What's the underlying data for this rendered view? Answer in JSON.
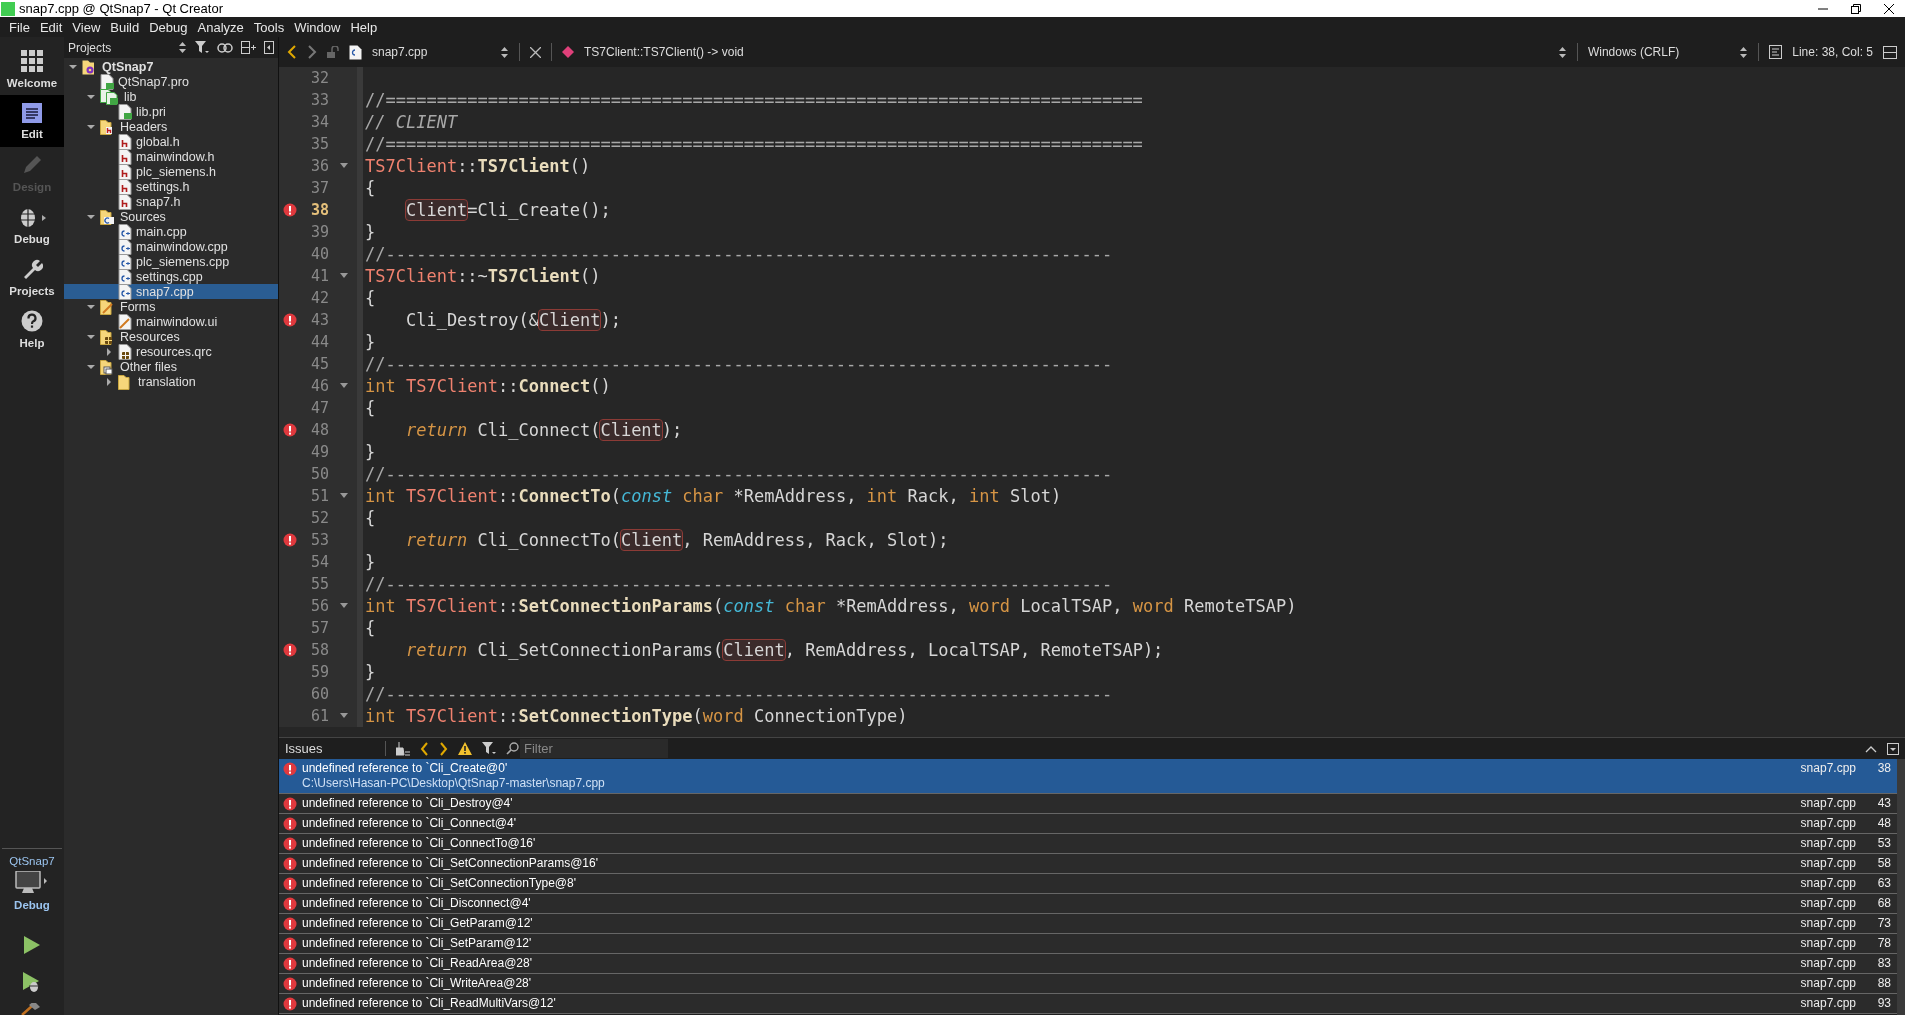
{
  "window": {
    "title": "snap7.cpp @ QtSnap7 - Qt Creator"
  },
  "menu": [
    "File",
    "Edit",
    "View",
    "Build",
    "Debug",
    "Analyze",
    "Tools",
    "Window",
    "Help"
  ],
  "modes": [
    {
      "kind": "welcome",
      "label": "Welcome",
      "selected": false,
      "disabled": false
    },
    {
      "kind": "edit",
      "label": "Edit",
      "selected": true,
      "disabled": false
    },
    {
      "kind": "design",
      "label": "Design",
      "selected": false,
      "disabled": true
    },
    {
      "kind": "debug",
      "label": "Debug",
      "selected": false,
      "disabled": false
    },
    {
      "kind": "projects",
      "label": "Projects",
      "selected": false,
      "disabled": false
    },
    {
      "kind": "help",
      "label": "Help",
      "selected": false,
      "disabled": false
    }
  ],
  "kit": {
    "project": "QtSnap7",
    "config": "Debug"
  },
  "projects": {
    "title": "Projects",
    "tree": [
      {
        "label": "QtSnap7",
        "kind": "project",
        "expanded": true,
        "selected": false,
        "children": [
          {
            "label": "QtSnap7.pro",
            "kind": "qtfile",
            "selected": false
          },
          {
            "label": "lib",
            "kind": "qtfolder",
            "expanded": true,
            "selected": false,
            "children": [
              {
                "label": "lib.pri",
                "kind": "qtfile",
                "selected": false
              }
            ]
          },
          {
            "label": "Headers",
            "kind": "hfolder",
            "expanded": true,
            "selected": false,
            "children": [
              {
                "label": "global.h",
                "kind": "h",
                "selected": false
              },
              {
                "label": "mainwindow.h",
                "kind": "h",
                "selected": false
              },
              {
                "label": "plc_siemens.h",
                "kind": "h",
                "selected": false
              },
              {
                "label": "settings.h",
                "kind": "h",
                "selected": false
              },
              {
                "label": "snap7.h",
                "kind": "h",
                "selected": false
              }
            ]
          },
          {
            "label": "Sources",
            "kind": "cppfolder",
            "expanded": true,
            "selected": false,
            "children": [
              {
                "label": "main.cpp",
                "kind": "cpp",
                "selected": false
              },
              {
                "label": "mainwindow.cpp",
                "kind": "cpp",
                "selected": false
              },
              {
                "label": "plc_siemens.cpp",
                "kind": "cpp",
                "selected": false
              },
              {
                "label": "settings.cpp",
                "kind": "cpp",
                "selected": false
              },
              {
                "label": "snap7.cpp",
                "kind": "cpp",
                "selected": true
              }
            ]
          },
          {
            "label": "Forms",
            "kind": "formfolder",
            "expanded": true,
            "selected": false,
            "children": [
              {
                "label": "mainwindow.ui",
                "kind": "ui",
                "selected": false
              }
            ]
          },
          {
            "label": "Resources",
            "kind": "resfolder",
            "expanded": true,
            "selected": false,
            "children": [
              {
                "label": "resources.qrc",
                "kind": "qrc",
                "expanded": false,
                "selected": false
              }
            ]
          },
          {
            "label": "Other files",
            "kind": "otherfolder",
            "expanded": true,
            "selected": false,
            "children": [
              {
                "label": "translation",
                "kind": "folder",
                "expanded": false,
                "selected": false
              }
            ]
          }
        ]
      }
    ]
  },
  "editor": {
    "file": "snap7.cpp",
    "symbol": "TS7Client::TS7Client() -> void",
    "line_ending": "Windows (CRLF)",
    "position": "Line: 38, Col: 5",
    "lines": [
      {
        "number": "32",
        "error": false,
        "fold": false,
        "current": false,
        "indent": false
      },
      {
        "number": "33",
        "error": false,
        "fold": false,
        "current": false,
        "indent": false,
        "tokens": [
          {
            "kind": "comment",
            "text": "//=========================================================================="
          }
        ]
      },
      {
        "number": "34",
        "error": false,
        "fold": false,
        "current": false,
        "indent": false,
        "tokens": [
          {
            "kind": "comment-italic",
            "text": "// CLIENT"
          }
        ]
      },
      {
        "number": "35",
        "error": false,
        "fold": false,
        "current": false,
        "indent": false,
        "tokens": [
          {
            "kind": "comment",
            "text": "//=========================================================================="
          }
        ]
      },
      {
        "number": "36",
        "error": false,
        "fold": true,
        "current": false,
        "indent": false,
        "tokens": [
          {
            "kind": "class",
            "text": "TS7Client"
          },
          {
            "kind": "plain",
            "text": "::"
          },
          {
            "kind": "func",
            "text": "TS7Client"
          },
          {
            "kind": "plain",
            "text": "()"
          }
        ]
      },
      {
        "number": "37",
        "error": false,
        "fold": false,
        "current": false,
        "indent": false,
        "tokens": [
          {
            "kind": "plain",
            "text": "{"
          }
        ]
      },
      {
        "number": "38",
        "error": true,
        "fold": false,
        "current": true,
        "indent": true,
        "tokens": [
          {
            "kind": "ref",
            "text": "Client"
          },
          {
            "kind": "plain",
            "text": "=Cli_Create();"
          }
        ]
      },
      {
        "number": "39",
        "error": false,
        "fold": false,
        "current": false,
        "indent": false,
        "tokens": [
          {
            "kind": "plain",
            "text": "}"
          }
        ]
      },
      {
        "number": "40",
        "error": false,
        "fold": false,
        "current": false,
        "indent": false,
        "tokens": [
          {
            "kind": "comment",
            "text": "//-----------------------------------------------------------------------"
          }
        ]
      },
      {
        "number": "41",
        "error": false,
        "fold": true,
        "current": false,
        "indent": false,
        "tokens": [
          {
            "kind": "class",
            "text": "TS7Client"
          },
          {
            "kind": "plain",
            "text": "::~"
          },
          {
            "kind": "func",
            "text": "TS7Client"
          },
          {
            "kind": "plain",
            "text": "()"
          }
        ]
      },
      {
        "number": "42",
        "error": false,
        "fold": false,
        "current": false,
        "indent": false,
        "tokens": [
          {
            "kind": "plain",
            "text": "{"
          }
        ]
      },
      {
        "number": "43",
        "error": true,
        "fold": false,
        "current": false,
        "indent": true,
        "tokens": [
          {
            "kind": "plain",
            "text": "Cli_Destroy(&"
          },
          {
            "kind": "ref",
            "text": "Client"
          },
          {
            "kind": "plain",
            "text": ");"
          }
        ]
      },
      {
        "number": "44",
        "error": false,
        "fold": false,
        "current": false,
        "indent": false,
        "tokens": [
          {
            "kind": "plain",
            "text": "}"
          }
        ]
      },
      {
        "number": "45",
        "error": false,
        "fold": false,
        "current": false,
        "indent": false,
        "tokens": [
          {
            "kind": "comment",
            "text": "//-----------------------------------------------------------------------"
          }
        ]
      },
      {
        "number": "46",
        "error": false,
        "fold": true,
        "current": false,
        "indent": false,
        "tokens": [
          {
            "kind": "keyword",
            "text": "int "
          },
          {
            "kind": "class",
            "text": "TS7Client"
          },
          {
            "kind": "plain",
            "text": "::"
          },
          {
            "kind": "func",
            "text": "Connect"
          },
          {
            "kind": "plain",
            "text": "()"
          }
        ]
      },
      {
        "number": "47",
        "error": false,
        "fold": false,
        "current": false,
        "indent": false,
        "tokens": [
          {
            "kind": "plain",
            "text": "{"
          }
        ]
      },
      {
        "number": "48",
        "error": true,
        "fold": false,
        "current": false,
        "indent": true,
        "tokens": [
          {
            "kind": "keyword-italic",
            "text": "return"
          },
          {
            "kind": "plain",
            "text": " Cli_Connect("
          },
          {
            "kind": "ref",
            "text": "Client"
          },
          {
            "kind": "plain",
            "text": ");"
          }
        ]
      },
      {
        "number": "49",
        "error": false,
        "fold": false,
        "current": false,
        "indent": false,
        "tokens": [
          {
            "kind": "plain",
            "text": "}"
          }
        ]
      },
      {
        "number": "50",
        "error": false,
        "fold": false,
        "current": false,
        "indent": false,
        "tokens": [
          {
            "kind": "comment",
            "text": "//-----------------------------------------------------------------------"
          }
        ]
      },
      {
        "number": "51",
        "error": false,
        "fold": true,
        "current": false,
        "indent": false,
        "tokens": [
          {
            "kind": "keyword",
            "text": "int "
          },
          {
            "kind": "class",
            "text": "TS7Client"
          },
          {
            "kind": "plain",
            "text": "::"
          },
          {
            "kind": "func",
            "text": "ConnectTo"
          },
          {
            "kind": "plain",
            "text": "("
          },
          {
            "kind": "qualifier",
            "text": "const "
          },
          {
            "kind": "keyword",
            "text": "char"
          },
          {
            "kind": "plain",
            "text": " *RemAddress, "
          },
          {
            "kind": "keyword",
            "text": "int"
          },
          {
            "kind": "plain",
            "text": " Rack, "
          },
          {
            "kind": "keyword",
            "text": "int"
          },
          {
            "kind": "plain",
            "text": " Slot)"
          }
        ]
      },
      {
        "number": "52",
        "error": false,
        "fold": false,
        "current": false,
        "indent": false,
        "tokens": [
          {
            "kind": "plain",
            "text": "{"
          }
        ]
      },
      {
        "number": "53",
        "error": true,
        "fold": false,
        "current": false,
        "indent": true,
        "tokens": [
          {
            "kind": "keyword-italic",
            "text": "return"
          },
          {
            "kind": "plain",
            "text": " Cli_ConnectTo("
          },
          {
            "kind": "ref",
            "text": "Client"
          },
          {
            "kind": "plain",
            "text": ", RemAddress, Rack, Slot);"
          }
        ]
      },
      {
        "number": "54",
        "error": false,
        "fold": false,
        "current": false,
        "indent": false,
        "tokens": [
          {
            "kind": "plain",
            "text": "}"
          }
        ]
      },
      {
        "number": "55",
        "error": false,
        "fold": false,
        "current": false,
        "indent": false,
        "tokens": [
          {
            "kind": "comment",
            "text": "//-----------------------------------------------------------------------"
          }
        ]
      },
      {
        "number": "56",
        "error": false,
        "fold": true,
        "current": false,
        "indent": false,
        "tokens": [
          {
            "kind": "keyword",
            "text": "int "
          },
          {
            "kind": "class",
            "text": "TS7Client"
          },
          {
            "kind": "plain",
            "text": "::"
          },
          {
            "kind": "func",
            "text": "SetConnectionParams"
          },
          {
            "kind": "plain",
            "text": "("
          },
          {
            "kind": "qualifier",
            "text": "const "
          },
          {
            "kind": "keyword",
            "text": "char"
          },
          {
            "kind": "plain",
            "text": " *RemAddress, "
          },
          {
            "kind": "keyword",
            "text": "word"
          },
          {
            "kind": "plain",
            "text": " LocalTSAP, "
          },
          {
            "kind": "keyword",
            "text": "word"
          },
          {
            "kind": "plain",
            "text": " RemoteTSAP)"
          }
        ]
      },
      {
        "number": "57",
        "error": false,
        "fold": false,
        "current": false,
        "indent": false,
        "tokens": [
          {
            "kind": "plain",
            "text": "{"
          }
        ]
      },
      {
        "number": "58",
        "error": true,
        "fold": false,
        "current": false,
        "indent": true,
        "tokens": [
          {
            "kind": "keyword-italic",
            "text": "return"
          },
          {
            "kind": "plain",
            "text": " Cli_SetConnectionParams("
          },
          {
            "kind": "ref",
            "text": "Client"
          },
          {
            "kind": "plain",
            "text": ", RemAddress, LocalTSAP, RemoteTSAP);"
          }
        ]
      },
      {
        "number": "59",
        "error": false,
        "fold": false,
        "current": false,
        "indent": false,
        "tokens": [
          {
            "kind": "plain",
            "text": "}"
          }
        ]
      },
      {
        "number": "60",
        "error": false,
        "fold": false,
        "current": false,
        "indent": false,
        "tokens": [
          {
            "kind": "comment",
            "text": "//-----------------------------------------------------------------------"
          }
        ]
      },
      {
        "number": "61",
        "error": false,
        "fold": true,
        "current": false,
        "indent": false,
        "tokens": [
          {
            "kind": "keyword",
            "text": "int "
          },
          {
            "kind": "class",
            "text": "TS7Client"
          },
          {
            "kind": "plain",
            "text": "::"
          },
          {
            "kind": "func",
            "text": "SetConnectionType"
          },
          {
            "kind": "plain",
            "text": "("
          },
          {
            "kind": "keyword",
            "text": "word"
          },
          {
            "kind": "plain",
            "text": " ConnectionType)"
          }
        ]
      }
    ]
  },
  "issues": {
    "title": "Issues",
    "filter_placeholder": "Filter",
    "items": [
      {
        "message": "undefined reference to `Cli_Create@0'",
        "path": "C:\\Users\\Hasan-PC\\Desktop\\QtSnap7-master\\snap7.cpp",
        "file": "snap7.cpp",
        "line": "38",
        "selected": true
      },
      {
        "message": "undefined reference to `Cli_Destroy@4'",
        "file": "snap7.cpp",
        "line": "43",
        "selected": false
      },
      {
        "message": "undefined reference to `Cli_Connect@4'",
        "file": "snap7.cpp",
        "line": "48",
        "selected": false
      },
      {
        "message": "undefined reference to `Cli_ConnectTo@16'",
        "file": "snap7.cpp",
        "line": "53",
        "selected": false
      },
      {
        "message": "undefined reference to `Cli_SetConnectionParams@16'",
        "file": "snap7.cpp",
        "line": "58",
        "selected": false
      },
      {
        "message": "undefined reference to `Cli_SetConnectionType@8'",
        "file": "snap7.cpp",
        "line": "63",
        "selected": false
      },
      {
        "message": "undefined reference to `Cli_Disconnect@4'",
        "file": "snap7.cpp",
        "line": "68",
        "selected": false
      },
      {
        "message": "undefined reference to `Cli_GetParam@12'",
        "file": "snap7.cpp",
        "line": "73",
        "selected": false
      },
      {
        "message": "undefined reference to `Cli_SetParam@12'",
        "file": "snap7.cpp",
        "line": "78",
        "selected": false
      },
      {
        "message": "undefined reference to `Cli_ReadArea@28'",
        "file": "snap7.cpp",
        "line": "83",
        "selected": false
      },
      {
        "message": "undefined reference to `Cli_WriteArea@28'",
        "file": "snap7.cpp",
        "line": "88",
        "selected": false
      },
      {
        "message": "undefined reference to `Cli_ReadMultiVars@12'",
        "file": "snap7.cpp",
        "line": "93",
        "selected": false
      }
    ]
  }
}
